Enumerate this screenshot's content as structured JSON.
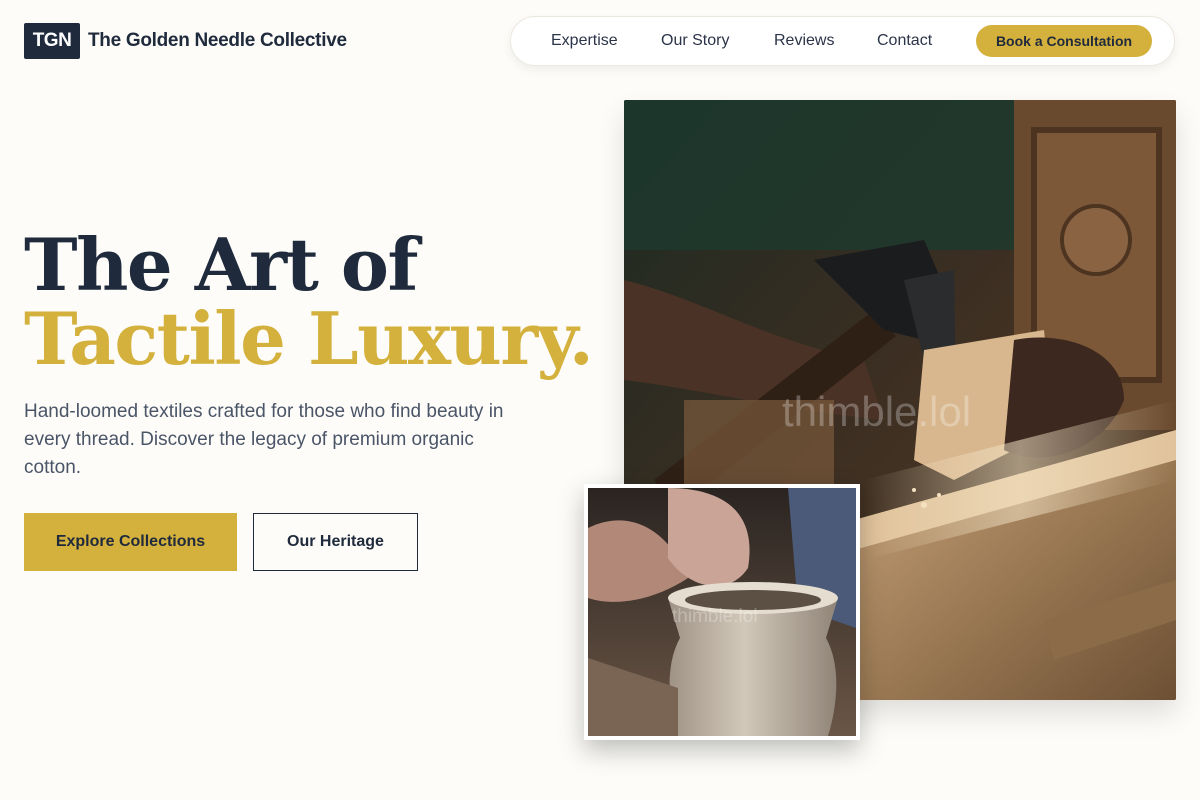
{
  "brand": {
    "logo_text": "TGN",
    "name": "The Golden Needle Collective"
  },
  "nav": {
    "links": [
      "Expertise",
      "Our Story",
      "Reviews",
      "Contact"
    ],
    "cta_label": "Book a Consultation"
  },
  "hero": {
    "headline_line1": "The Art of",
    "headline_line2": "Tactile Luxury.",
    "subtitle": "Hand-loomed textiles crafted for those who find beauty in every thread. Discover the legacy of premium organic cotton.",
    "primary_button": "Explore Collections",
    "secondary_button": "Our Heritage"
  },
  "images": {
    "main_watermark": "thimble.lol",
    "inset_watermark": "thimble.lol"
  },
  "colors": {
    "background": "#fdfcf8",
    "navy": "#1f2a3d",
    "gold": "#d4b03c",
    "muted_text": "#4b5568"
  }
}
